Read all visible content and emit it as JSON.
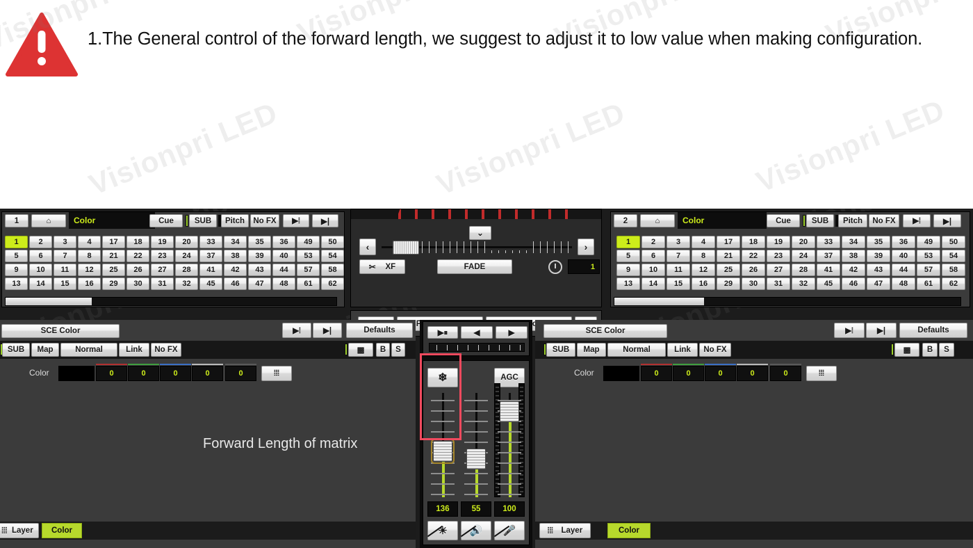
{
  "note": {
    "icon": "warning-triangle-icon",
    "text": "1.The General control of the forward length, we suggest to adjust it to low value when making configuration.",
    "icon_color": "#dd3333"
  },
  "watermark": {
    "text": "Visionpri LED"
  },
  "annotation": {
    "forward_length_label": "Forward Length of matrix",
    "highlight_color": "#f04a5e"
  },
  "playback_left": {
    "index": "1",
    "home_icon": "home-icon",
    "title": "Color",
    "buttons": [
      "Cue",
      "SUB",
      "Pitch",
      "No FX"
    ],
    "nav_icons": [
      "skip-to-list-icon",
      "skip-forward-icon"
    ],
    "selected_cell": "1",
    "groups": [
      [
        "1",
        "2",
        "3",
        "4",
        "5",
        "6",
        "7",
        "8",
        "9",
        "10",
        "11",
        "12",
        "13",
        "14",
        "15",
        "16"
      ],
      [
        "17",
        "18",
        "19",
        "20",
        "21",
        "22",
        "23",
        "24",
        "25",
        "26",
        "27",
        "28",
        "29",
        "30",
        "31",
        "32"
      ],
      [
        "33",
        "34",
        "35",
        "36",
        "37",
        "38",
        "39",
        "40",
        "41",
        "42",
        "43",
        "44",
        "45",
        "46",
        "47",
        "48"
      ],
      [
        "49",
        "50",
        "53",
        "54",
        "57",
        "58",
        "61",
        "62"
      ]
    ],
    "scroll_fill_pct": 26
  },
  "playback_right": {
    "index": "2",
    "home_icon": "home-icon",
    "title": "Color",
    "buttons": [
      "Cue",
      "SUB",
      "Pitch",
      "No FX"
    ],
    "nav_icons": [
      "skip-to-list-icon",
      "skip-forward-icon"
    ],
    "selected_cell": "1",
    "groups": [
      [
        "1",
        "2",
        "3",
        "4",
        "5",
        "6",
        "7",
        "8",
        "9",
        "10",
        "11",
        "12",
        "13",
        "14",
        "15",
        "16"
      ],
      [
        "17",
        "18",
        "19",
        "20",
        "21",
        "22",
        "23",
        "24",
        "25",
        "26",
        "27",
        "28",
        "29",
        "30",
        "31",
        "32"
      ],
      [
        "33",
        "34",
        "35",
        "36",
        "37",
        "38",
        "39",
        "40",
        "41",
        "42",
        "43",
        "44",
        "45",
        "46",
        "47",
        "48"
      ],
      [
        "49",
        "50",
        "53",
        "54",
        "57",
        "58",
        "61",
        "62"
      ]
    ],
    "scroll_fill_pct": 26
  },
  "crossfade": {
    "collapse_icon": "chevron-down-icon",
    "prev_icon": "chevron-left-icon",
    "next_icon": "chevron-right-icon",
    "xf_label": "XF",
    "xf_icon": "crossfade-icon",
    "fade_label": "FADE",
    "clock_icon": "clock-icon",
    "time_value": "1",
    "slider_position_pct": 6
  },
  "command_row": {
    "rec_label": "REC",
    "programmer_label": "Programmer",
    "layer_control_label": "Layer Control",
    "more_icon": "skip-forward-icon"
  },
  "sce_left": {
    "title": "SCE Color",
    "nav_icons": [
      "skip-to-list-icon",
      "skip-forward-icon"
    ],
    "defaults_label": "Defaults",
    "mode_buttons": [
      "SUB",
      "Map",
      "Normal",
      "Link",
      "No FX"
    ],
    "right_buttons": [
      "checker-icon",
      "B",
      "S"
    ],
    "color_label": "Color",
    "swatch": "#000000",
    "values": [
      "0",
      "0",
      "0",
      "0",
      "0"
    ],
    "strip_colors": [
      "#b13030",
      "#3f9e3f",
      "#3a6fc4",
      "#b9b9b9",
      "#5a5a5a"
    ],
    "fader_icon": "faders-icon"
  },
  "sce_right": {
    "title": "SCE Color",
    "nav_icons": [
      "skip-to-list-icon",
      "skip-forward-icon"
    ],
    "defaults_label": "Defaults",
    "mode_buttons": [
      "SUB",
      "Map",
      "Normal",
      "Link",
      "No FX"
    ],
    "right_buttons": [
      "checker-icon",
      "B",
      "S"
    ],
    "color_label": "Color",
    "swatch": "#000000",
    "values": [
      "0",
      "0",
      "0",
      "0",
      "0"
    ],
    "strip_colors": [
      "#b13030",
      "#3f9e3f",
      "#3a6fc4",
      "#b9b9b9",
      "#5a5a5a"
    ],
    "fader_icon": "faders-icon"
  },
  "transport": {
    "play_pause_icon": "play-pause-icon",
    "back_icon": "triangle-left-icon",
    "forward_icon": "triangle-right-icon"
  },
  "faders": {
    "freeze_icon": "snowflake-icon",
    "agc_label": "AGC",
    "channels": [
      {
        "name": "grand-master",
        "value": "136",
        "fill_pct": 47,
        "handle_top_pct": 46,
        "selected": true,
        "bottom_icon": "blackout-icon"
      },
      {
        "name": "speed",
        "value": "55",
        "fill_pct": 40,
        "handle_top_pct": 53,
        "selected": false,
        "bottom_icon": "mute-sound-icon"
      },
      {
        "name": "audio-level",
        "value": "100",
        "fill_pct": 72,
        "handle_top_pct": 8,
        "selected": false,
        "bottom_icon": "mute-mic-icon"
      }
    ]
  },
  "tabs_left": {
    "layer_label": "Layer",
    "color_label": "Color",
    "fader_icon": "faders-icon"
  },
  "tabs_right": {
    "layer_label": "Layer",
    "color_label": "Color",
    "fader_icon": "faders-icon"
  }
}
